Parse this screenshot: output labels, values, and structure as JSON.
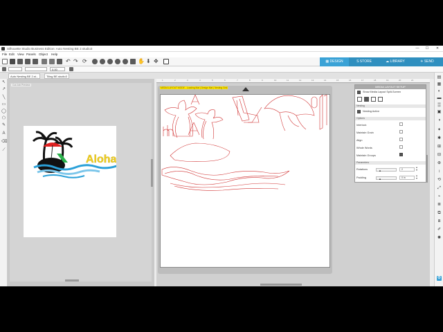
{
  "window": {
    "title": "Silhouette Studio Business Edition: Auto Nesting BE 2.studio3",
    "minimize": "—",
    "maximize": "☐",
    "close": "✕"
  },
  "menu": [
    "File",
    "Edit",
    "View",
    "Panels",
    "Object",
    "Help"
  ],
  "nav_tabs": {
    "design": "DESIGN",
    "store": "STORE",
    "library": "LIBRARY",
    "send": "SEND"
  },
  "toolbar2": {
    "zoom_value": "0.00"
  },
  "doc_tabs": [
    "Auto Nesting BE 2.st...",
    "Tiling BE.studio3"
  ],
  "left_panel": {
    "label": "Cut Job Preview",
    "aloha_text": "Aloha"
  },
  "canvas": {
    "yellow_label": "MEDIA LAYOUT MODE - Loading Mat | Design Mat | Nesting Grid"
  },
  "ruler_ticks": [
    "1",
    "2",
    "3",
    "4",
    "5",
    "6",
    "7",
    "8",
    "9",
    "10",
    "11",
    "12",
    "13",
    "14",
    "15",
    "16",
    "17",
    "18",
    "19",
    "20",
    "21"
  ],
  "media_panel": {
    "title": "MEDIA LAYOUT SETUP",
    "show_split": "Show Media Layout Split-Screen",
    "nesting_section": "Nesting",
    "nesting_active": "Nesting Active",
    "options_section": "Options",
    "options": [
      {
        "label": "Interlock",
        "checked": false
      },
      {
        "label": "Maintain Grain",
        "checked": false
      },
      {
        "label": "Align",
        "checked": false
      },
      {
        "label": "Whole Words",
        "checked": false
      },
      {
        "label": "Maintain Groups",
        "checked": true
      }
    ],
    "parameters_section": "Parameters",
    "rotations_label": "Rotations",
    "rotations_value": "2",
    "padding_label": "Padding",
    "padding_value": "0",
    "rotations_unit": "",
    "padding_unit": "in"
  },
  "colors": {
    "design_tab": "#3aa2d6",
    "tab_bar": "#2f8fbf",
    "cut_line": "#d03030"
  }
}
